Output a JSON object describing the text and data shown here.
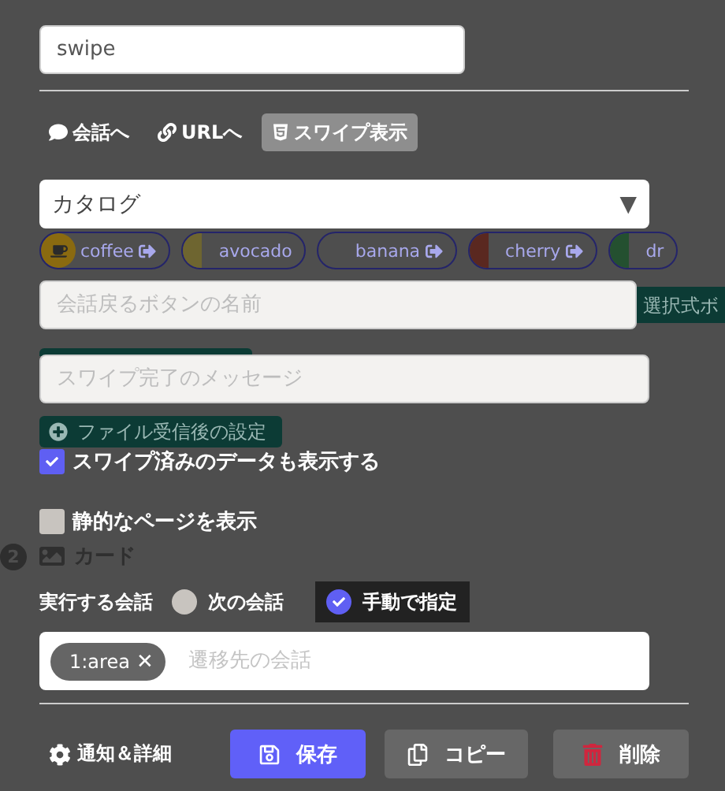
{
  "name_field": {
    "value": "swipe"
  },
  "nav_links": [
    {
      "kind": "chat",
      "label": "会話へ",
      "selected": false
    },
    {
      "kind": "link",
      "label": "URLへ",
      "selected": false
    },
    {
      "kind": "html",
      "label": "スワイプ表示",
      "selected": true
    }
  ],
  "catalog_select": {
    "value": "カタログ",
    "caret": "▼"
  },
  "catalog_chips": [
    {
      "label": "coffee",
      "color": "#8a6a10",
      "kind": "icon"
    },
    {
      "label": "avocado",
      "color": "#6e6530",
      "kind": "plain"
    },
    {
      "label": "banana",
      "kind": "arrow"
    },
    {
      "label": "cherry",
      "color": "#5a2820",
      "kind": "arrow"
    },
    {
      "label": "dr",
      "color": "#245030",
      "kind": "plain"
    }
  ],
  "back_button_field": {
    "placeholder": "会話戻るボタンの名前"
  },
  "choice_tag": "選択式ボ",
  "complete_message_field": {
    "placeholder": "スワイプ完了のメッセージ"
  },
  "file_settings_button": "ファイル受信後の設定",
  "checkboxes": [
    {
      "label": "スワイプ済みのデータも表示する",
      "checked": true
    },
    {
      "label": "静的なページを表示",
      "checked": false
    }
  ],
  "card_section": {
    "badge": "2",
    "title": "カード"
  },
  "conversation": {
    "label": "実行する会話",
    "options": [
      {
        "label": "次の会話",
        "selected": false
      },
      {
        "label": "手動で指定",
        "selected": true
      }
    ]
  },
  "target_field": {
    "tags": [
      {
        "label": "1:area",
        "remove": "✕"
      }
    ],
    "placeholder": "遷移先の会話"
  },
  "footer": {
    "settings": "通知＆詳細",
    "buttons": [
      {
        "kind": "save",
        "label": "保存"
      },
      {
        "kind": "copy",
        "label": "コピー"
      },
      {
        "kind": "delete",
        "label": "削除"
      }
    ]
  }
}
